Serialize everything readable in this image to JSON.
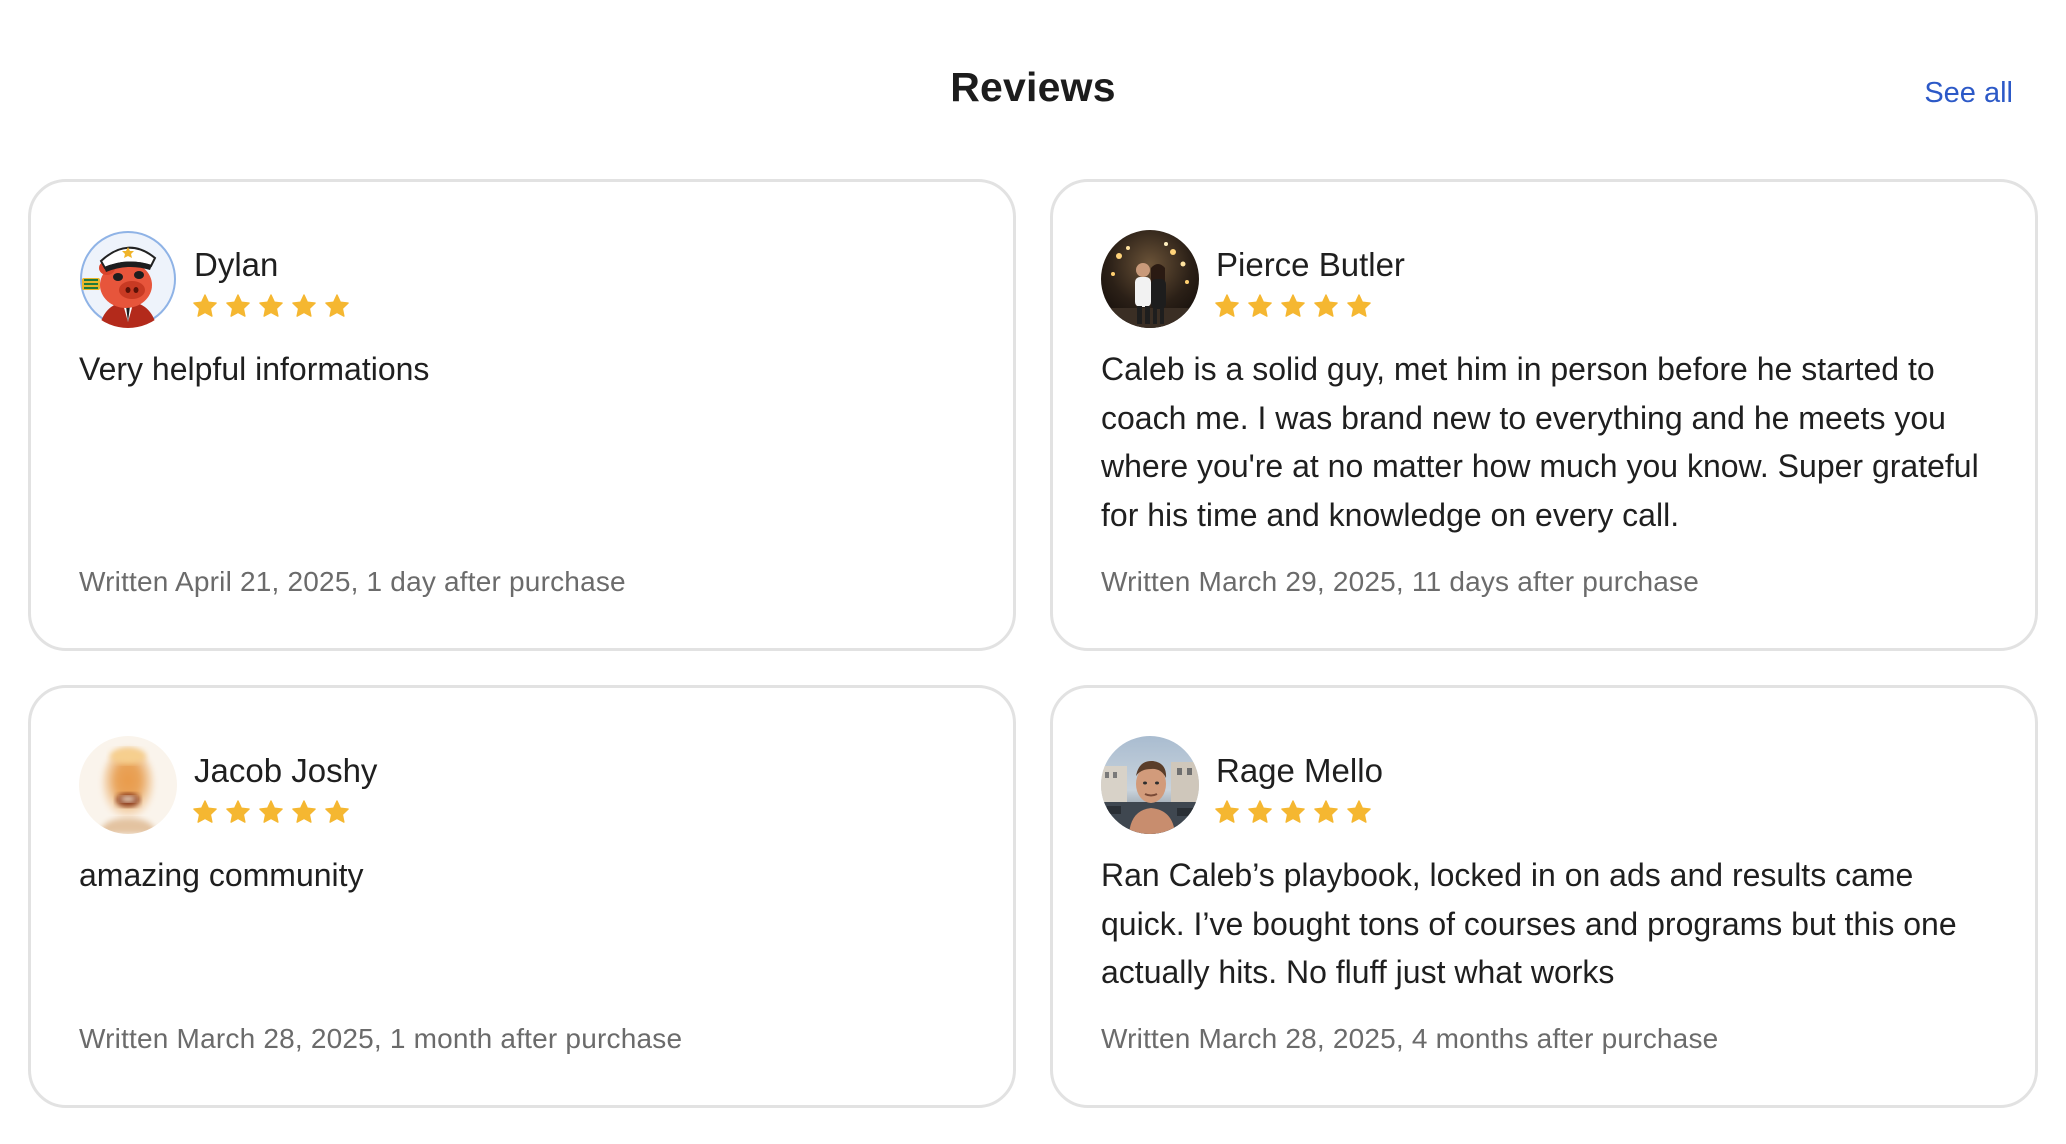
{
  "header": {
    "title": "Reviews",
    "see_all_label": "See all"
  },
  "colors": {
    "star": "#f5b731",
    "link": "#2c59c7",
    "border": "#e2e2e2",
    "meta_text": "#6b6b6b"
  },
  "reviews": [
    {
      "name": "Dylan",
      "rating": 5,
      "avatar": "cartoon-pig-captain-avatar",
      "text": "Very helpful informations",
      "meta": "Written April 21, 2025, 1 day after purchase"
    },
    {
      "name": "Pierce Butler",
      "rating": 5,
      "avatar": "couple-photo-avatar",
      "text": "Caleb is a solid guy, met him in person before he started to coach me. I was brand new to everything and he meets you where you're at no matter how much you know. Super grateful for his time and knowledge on every call.",
      "meta": "Written March 29, 2025, 11 days after purchase"
    },
    {
      "name": "Jacob Joshy",
      "rating": 5,
      "avatar": "blurred-face-avatar",
      "text": "amazing community",
      "meta": "Written March 28, 2025, 1 month after purchase"
    },
    {
      "name": "Rage Mello",
      "rating": 5,
      "avatar": "selfie-photo-avatar",
      "text": "Ran Caleb’s playbook, locked in on ads and results came quick. I’ve bought tons of courses and programs but this one actually hits. No fluff just what works",
      "meta": "Written March 28, 2025, 4 months after purchase"
    }
  ]
}
